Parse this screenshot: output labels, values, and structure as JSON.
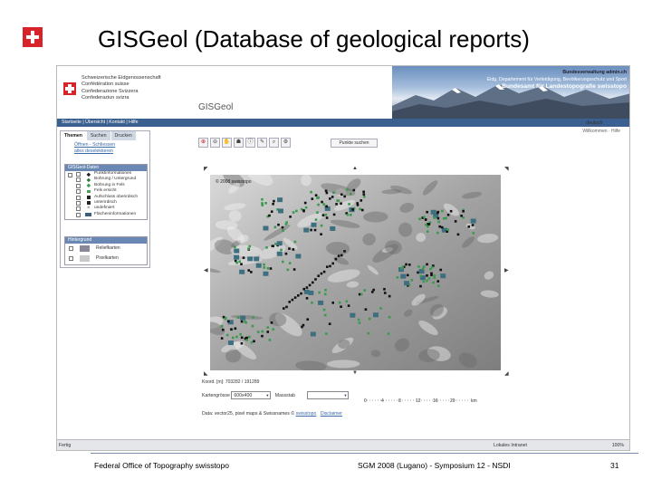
{
  "slide": {
    "title": "GISGeol  (Database of geological reports)",
    "footer_left": "Federal Office of Topography swisstopo",
    "footer_center": "SGM 2008 (Lugano) - Symposium 12 - NSDI",
    "page_number": "31"
  },
  "browser": {
    "header": {
      "confederation_lines": [
        "Schweizerische Eidgenossenschaft",
        "Confédération suisse",
        "Confederazione Svizzera",
        "Confederaziun svizra"
      ],
      "admin_domain": "Bundesverwaltung admin.ch",
      "department": "Eidg. Departement für Verteidigung, Bevölkerungsschutz und Sport",
      "office": "Bundesamt für Landestopografie swisstopo",
      "app_title": "GISGeol"
    },
    "nav": {
      "links": "Startseite | Übersicht | Kontakt | Hilfe",
      "lang_active": "deutsch",
      "lang_other": "français",
      "contact": "Willkommen · Hilfe"
    },
    "panel": {
      "tabs": [
        "Themen",
        "Suchen",
        "Drucken"
      ],
      "links": [
        "Öffnen - Schliessen",
        "alles deselektieren"
      ],
      "group_title": "GISGeol-Daten",
      "layers": [
        {
          "label": "Punktinformationen",
          "color": "#222222",
          "shape": "diamond"
        },
        {
          "label": "Bohrung / Untergrund",
          "color": "#2f7a3a",
          "shape": "diamond"
        },
        {
          "label": "Bohrung in Fels",
          "color": "#3c9a4e",
          "shape": "diamond"
        },
        {
          "label": "Fels ersicht",
          "color": "#4aa05a",
          "shape": "square"
        },
        {
          "label": "Aufschluss oberirdisch",
          "color": "#222222",
          "shape": "square"
        },
        {
          "label": "unterirdisch",
          "color": "#222222",
          "shape": "square"
        },
        {
          "label": "undefiniert",
          "color": "#555555",
          "shape": "cross"
        },
        {
          "label": "Flächeninformationen",
          "color": "#3d5f7e",
          "shape": "rect"
        }
      ],
      "background_title": "Hintergrund",
      "background_layers": [
        "Reliefkarten",
        "Pixelkarten"
      ]
    },
    "toolbar": {
      "tools": [
        "⊕",
        "⊖",
        "✋",
        "☗",
        "ⓘ",
        "✎",
        "⌕",
        "⚙"
      ],
      "search_button": "Punkte suchen"
    },
    "map": {
      "copyright": "© 2008 swisstopo",
      "coordinates": "Koord. [m]: 703282 / 191289",
      "scale_label": "Kartengrösse",
      "scale_value": "600x400",
      "massstab_label": "Massstab",
      "scale_ticks": [
        "0",
        "4",
        "8",
        "12",
        "16",
        "20"
      ],
      "scale_unit": "km",
      "data_sources": "Data: vector25, pixel maps & Swissnames ©",
      "data_link": "swisstopo",
      "disclaimer": "Disclaimer"
    },
    "status": {
      "left": "Fertig",
      "middle": "Lokales Intranet",
      "zoom": "100%"
    },
    "colors": {
      "navbar": "#3b5f8e",
      "point_black": "#111111",
      "point_green": "#3c9a4e",
      "area_teal": "#3d6f7e"
    }
  }
}
